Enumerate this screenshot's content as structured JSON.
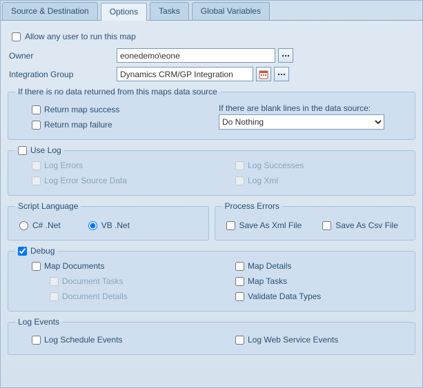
{
  "tabs": [
    {
      "label": "Source & Destination"
    },
    {
      "label": "Options"
    },
    {
      "label": "Tasks"
    },
    {
      "label": "Global Variables"
    }
  ],
  "allow_any_user": {
    "label": "Allow any user to run this map",
    "checked": false
  },
  "owner": {
    "label": "Owner",
    "value": "eonedemo\\eone"
  },
  "integration_group": {
    "label": "Integration Group",
    "value": "Dynamics CRM/GP Integration"
  },
  "no_data": {
    "legend": "If there is no data returned from this maps data source",
    "return_success": {
      "label": "Return map success",
      "checked": false
    },
    "return_failure": {
      "label": "Return map failure",
      "checked": false
    },
    "blank_lines_label": "If there are blank lines in the data source:",
    "blank_lines_value": "Do Nothing"
  },
  "use_log": {
    "legend": "Use Log",
    "checked": false,
    "log_errors": {
      "label": "Log Errors"
    },
    "log_error_source": {
      "label": "Log Error Source Data"
    },
    "log_successes": {
      "label": "Log Successes"
    },
    "log_xml": {
      "label": "Log Xml"
    }
  },
  "script_lang": {
    "legend": "Script Language",
    "csharp": {
      "label": "C# .Net"
    },
    "vb": {
      "label": "VB .Net"
    },
    "selected": "vb"
  },
  "process_errors": {
    "legend": "Process Errors",
    "xml": {
      "label": "Save As Xml File",
      "checked": false
    },
    "csv": {
      "label": "Save As Csv File",
      "checked": false
    }
  },
  "debug": {
    "legend": "Debug",
    "checked": true,
    "map_documents": {
      "label": "Map Documents",
      "checked": false
    },
    "document_tasks": {
      "label": "Document Tasks"
    },
    "document_details": {
      "label": "Document Details"
    },
    "map_details": {
      "label": "Map Details",
      "checked": false
    },
    "map_tasks": {
      "label": "Map Tasks",
      "checked": false
    },
    "validate": {
      "label": "Validate Data Types",
      "checked": false
    }
  },
  "log_events": {
    "legend": "Log Events",
    "schedule": {
      "label": "Log Schedule Events",
      "checked": false
    },
    "webservice": {
      "label": "Log Web Service Events",
      "checked": false
    }
  }
}
